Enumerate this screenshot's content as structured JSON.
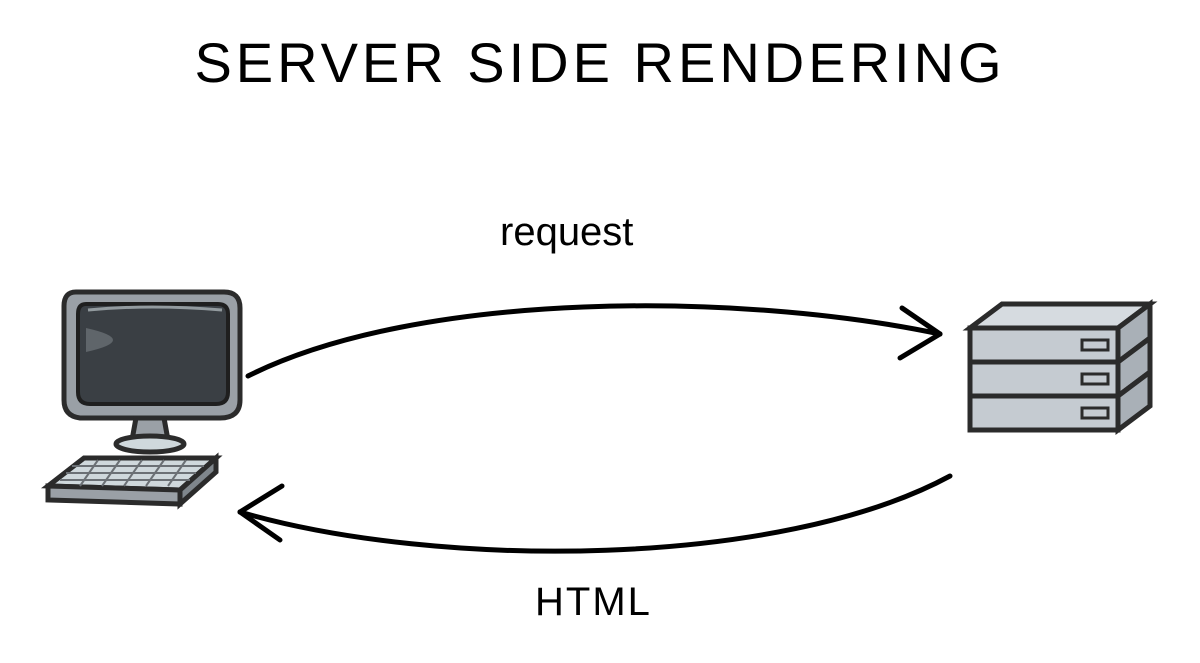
{
  "title": "SERVER SIDE RENDERING",
  "labels": {
    "request": "request",
    "response": "HTML"
  },
  "nodes": {
    "client": "computer",
    "server": "server-stack"
  },
  "flow": [
    {
      "from": "client",
      "to": "server",
      "label_key": "request"
    },
    {
      "from": "server",
      "to": "client",
      "label_key": "response"
    }
  ]
}
